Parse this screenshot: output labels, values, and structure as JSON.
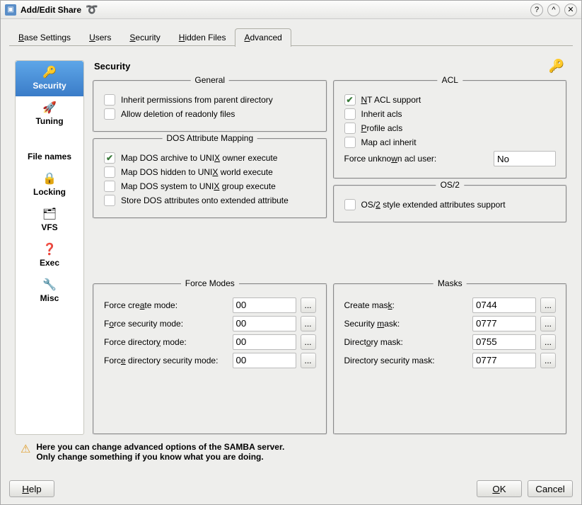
{
  "window": {
    "title": "Add/Edit Share"
  },
  "titlebar_buttons": {
    "help": "?",
    "up": "^",
    "close": "✕"
  },
  "tabs": [
    {
      "label": "Base Settings",
      "accel": "B"
    },
    {
      "label": "Users",
      "accel": "U"
    },
    {
      "label": "Security",
      "accel": "S"
    },
    {
      "label": "Hidden Files",
      "accel": "H"
    },
    {
      "label": "Advanced",
      "accel": "A"
    }
  ],
  "sidebar": {
    "items": [
      {
        "label": "Security",
        "icon": "🔑"
      },
      {
        "label": "Tuning",
        "icon": "🚀"
      },
      {
        "label": "File names",
        "icon": ""
      },
      {
        "label": "Locking",
        "icon": "🔒"
      },
      {
        "label": "VFS",
        "icon": "🗂"
      },
      {
        "label": "Exec",
        "icon": "❓"
      },
      {
        "label": "Misc",
        "icon": "🔧"
      }
    ]
  },
  "section": {
    "title": "Security"
  },
  "general": {
    "title": "General",
    "inherit_permissions": "Inherit permissions from parent directory",
    "allow_deletion": "Allow deletion of readonly files"
  },
  "dos": {
    "title": "DOS Attribute Mapping",
    "archive": "Map DOS archive to UNIX owner execute",
    "hidden": "Map DOS hidden to UNIX world execute",
    "system": "Map DOS system to UNIX group execute",
    "store": "Store DOS attributes onto extended attribute"
  },
  "acl": {
    "title": "ACL",
    "nt_support": "NT ACL support",
    "inherit": "Inherit acls",
    "profile": "Profile acls",
    "map_inherit": "Map acl inherit",
    "force_unknown_label": "Force unknown acl user:",
    "force_unknown_value": "No"
  },
  "os2": {
    "title": "OS/2",
    "extended": "OS/2 style extended attributes support"
  },
  "force_modes": {
    "title": "Force Modes",
    "create_label": "Force create mode:",
    "create_value": "00",
    "security_label": "Force security mode:",
    "security_value": "00",
    "directory_label": "Force directory mode:",
    "directory_value": "00",
    "dir_security_label": "Force directory security mode:",
    "dir_security_value": "00"
  },
  "masks": {
    "title": "Masks",
    "create_label": "Create mask:",
    "create_value": "0744",
    "security_label": "Security mask:",
    "security_value": "0777",
    "directory_label": "Directory mask:",
    "directory_value": "0755",
    "dir_security_label": "Directory security mask:",
    "dir_security_value": "0777"
  },
  "notice": {
    "line1": "Here you can change advanced options of the SAMBA server.",
    "line2": "Only change something if you know what you are doing."
  },
  "footer": {
    "help": "Help",
    "ok": "OK",
    "cancel": "Cancel"
  },
  "ellipsis": "..."
}
